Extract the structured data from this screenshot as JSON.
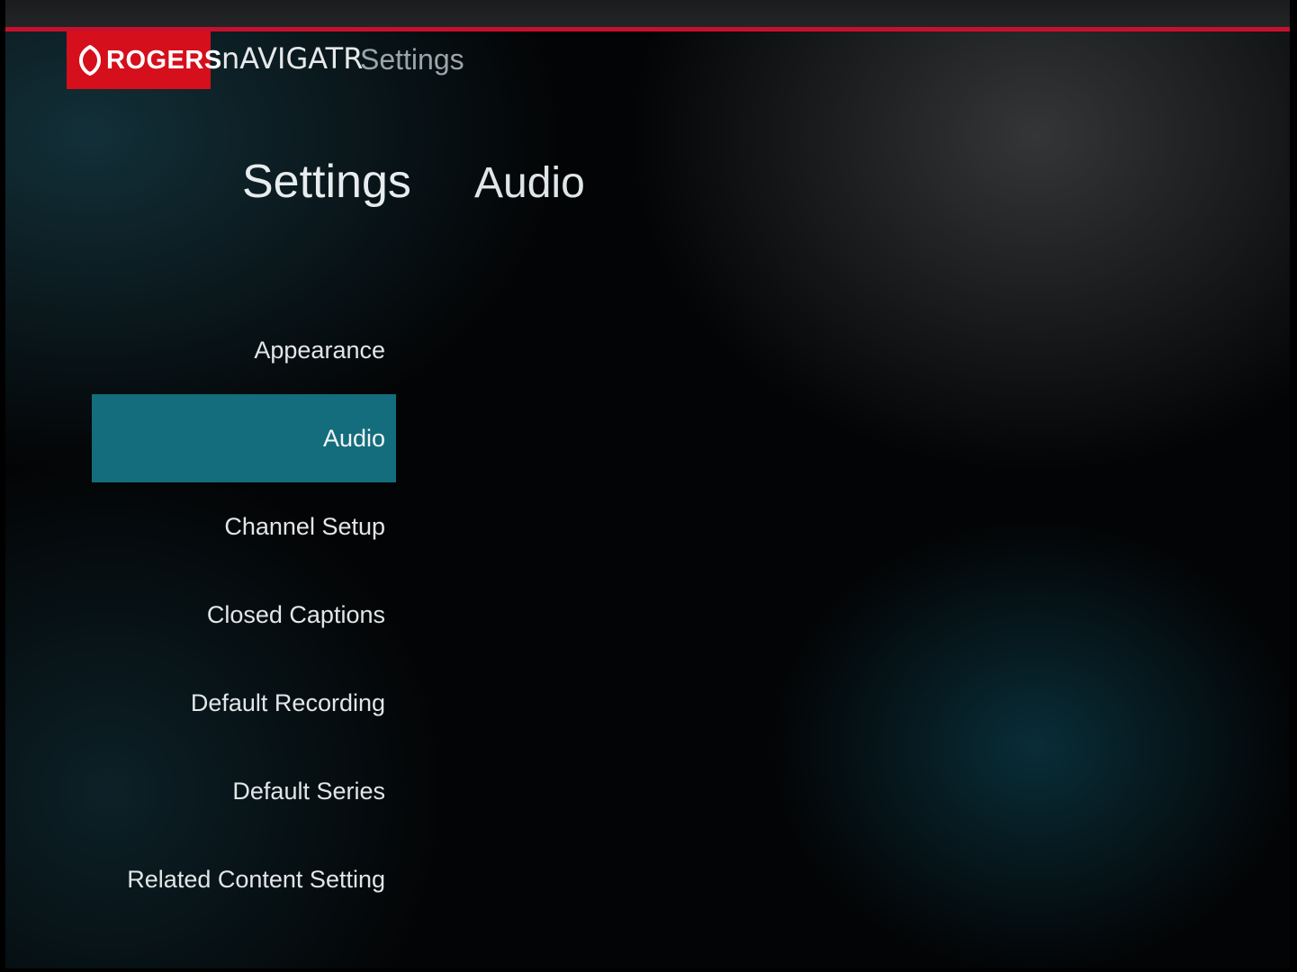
{
  "header": {
    "brand": "ROGERS",
    "product": "nAVIGATR",
    "breadcrumb": "Settings",
    "colors": {
      "brand_red": "#d50f1c",
      "accent_line": "#c8102e"
    }
  },
  "main": {
    "title": "Settings",
    "section": "Audio"
  },
  "menu": {
    "selected_color": "#146d7c",
    "items": [
      {
        "label": "Appearance",
        "selected": false
      },
      {
        "label": "Audio",
        "selected": true
      },
      {
        "label": "Channel Setup",
        "selected": false
      },
      {
        "label": "Closed Captions",
        "selected": false
      },
      {
        "label": "Default Recording",
        "selected": false
      },
      {
        "label": "Default Series",
        "selected": false
      },
      {
        "label": "Related Content Setting",
        "selected": false
      }
    ]
  }
}
